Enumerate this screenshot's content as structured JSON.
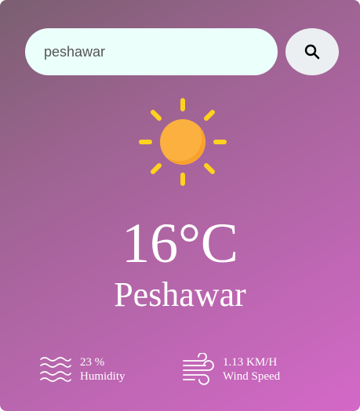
{
  "search": {
    "value": "peshawar",
    "button_icon": "search-icon"
  },
  "weather": {
    "icon": "sun-icon",
    "temperature": "16°C",
    "city": "Peshawar"
  },
  "details": {
    "humidity": {
      "icon": "humidity-icon",
      "value": "23 %",
      "label": "Humidity"
    },
    "wind": {
      "icon": "wind-icon",
      "value": "1.13 KM/H",
      "label": "Wind Speed"
    }
  },
  "colors": {
    "sun": "#fbb040",
    "sun_rays": "#ffd21f",
    "gradient_start": "#7a5f70",
    "gradient_end": "#d468c8"
  }
}
